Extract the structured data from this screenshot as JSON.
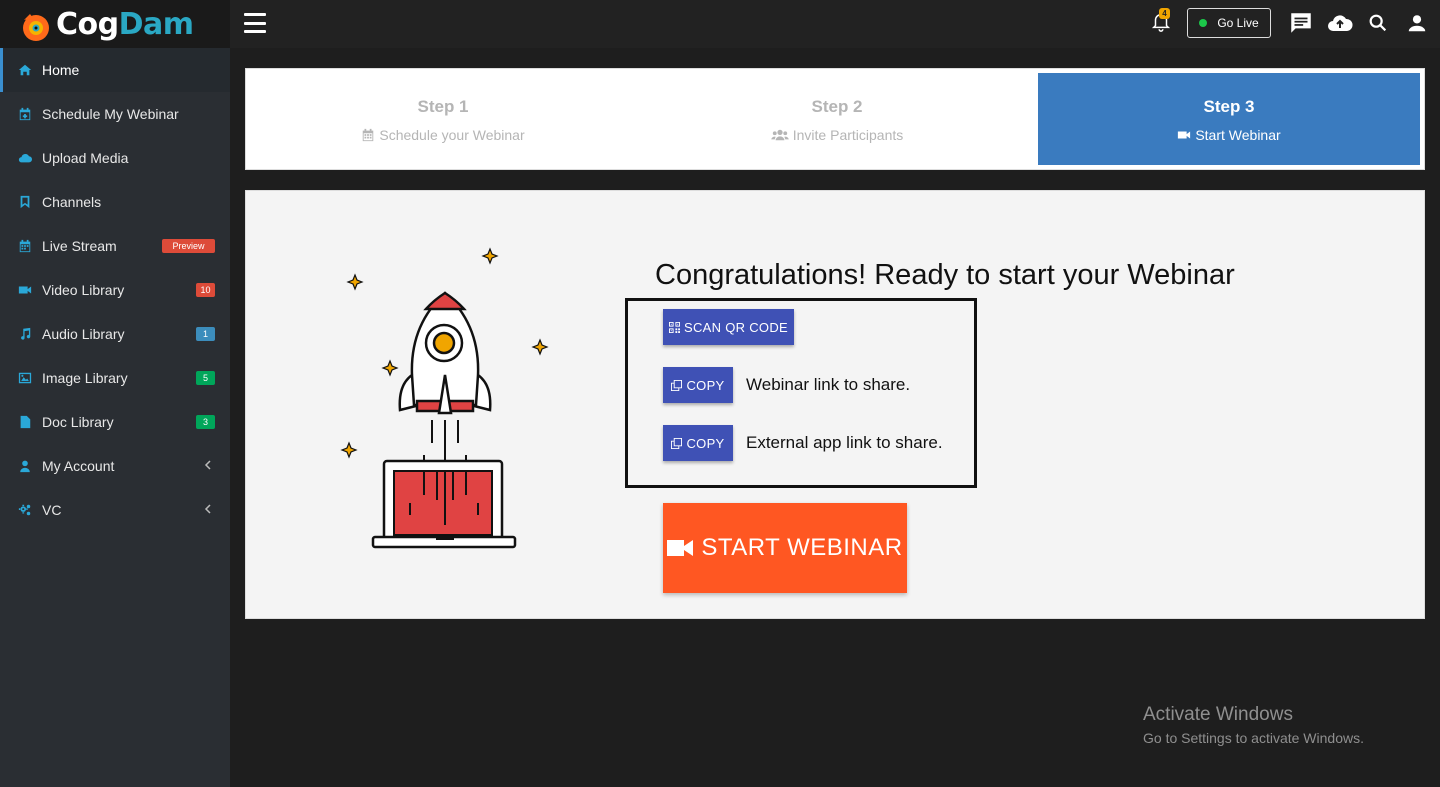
{
  "header": {
    "logo_part1": "Cog",
    "logo_part2": "Dam",
    "notification_count": "4",
    "go_live_label": "Go Live",
    "icons": [
      "menu-icon",
      "bell-icon",
      "chat-icon",
      "cloud-upload-icon",
      "search-icon",
      "user-icon"
    ]
  },
  "sidebar": {
    "items": [
      {
        "label": "Home",
        "icon": "home-icon"
      },
      {
        "label": "Schedule My Webinar",
        "icon": "calendar-plus-icon"
      },
      {
        "label": "Upload Media",
        "icon": "cloud-upload-icon"
      },
      {
        "label": "Channels",
        "icon": "bookmark-icon"
      },
      {
        "label": "Live Stream",
        "icon": "calendar-icon",
        "badge": "Preview"
      },
      {
        "label": "Video Library",
        "icon": "video-icon",
        "badge": "10"
      },
      {
        "label": "Audio Library",
        "icon": "music-icon",
        "badge": "1"
      },
      {
        "label": "Image Library",
        "icon": "image-icon",
        "badge": "5"
      },
      {
        "label": "Doc Library",
        "icon": "file-icon",
        "badge": "3"
      },
      {
        "label": "My Account",
        "icon": "user-icon"
      },
      {
        "label": "VC",
        "icon": "cogs-icon"
      }
    ]
  },
  "steps": [
    {
      "title": "Step 1",
      "subtitle": "Schedule your Webinar",
      "icon": "calendar-icon"
    },
    {
      "title": "Step 2",
      "subtitle": "Invite Participants",
      "icon": "users-icon"
    },
    {
      "title": "Step 3",
      "subtitle": "Start Webinar",
      "icon": "video-icon",
      "active": true
    }
  ],
  "main": {
    "heading": "Congratulations! Ready to start your Webinar",
    "scan_qr_label": "SCAN QR CODE",
    "copy_label": "COPY",
    "webinar_link_text": "Webinar link to share.",
    "external_link_text": "External app link to share.",
    "start_button_label": "START WEBINAR"
  },
  "watermark": {
    "line1": "Activate Windows",
    "line2": "Go to Settings to activate Windows."
  },
  "colors": {
    "accent_blue": "#3a7bbf",
    "button_indigo": "#3f51b5",
    "start_orange": "#ff5722",
    "sidebar_bg": "#2a2e33"
  }
}
